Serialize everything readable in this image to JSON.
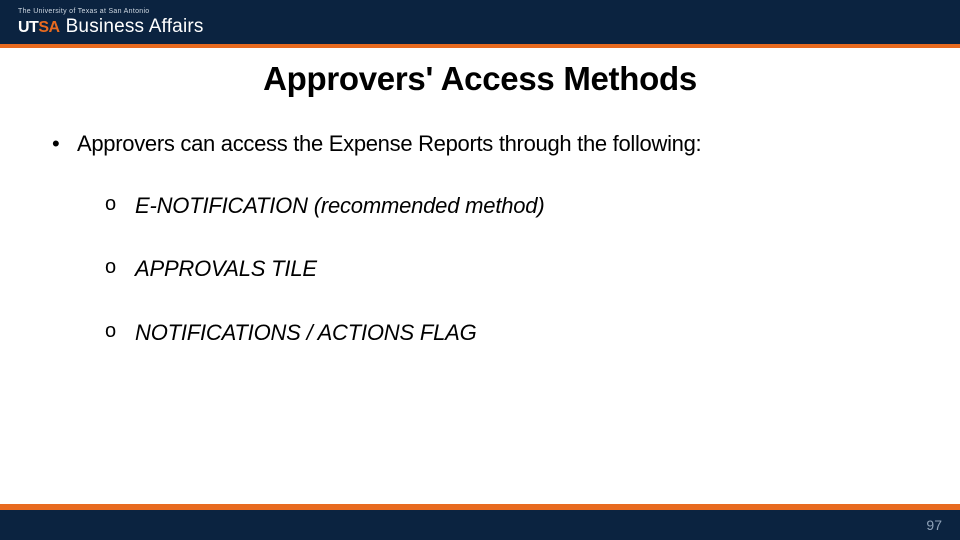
{
  "header": {
    "institution_line": "The University of Texas at San Antonio",
    "logo_mark_pre": "UT",
    "logo_mark_post": "SA",
    "department": "Business Affairs"
  },
  "title": "Approvers' Access Methods",
  "content": {
    "intro": "Approvers can access the Expense Reports through the following:",
    "methods": [
      "E-NOTIFICATION (recommended method)",
      "APPROVALS TILE",
      "NOTIFICATIONS / ACTIONS FLAG"
    ]
  },
  "footer": {
    "page_number": "97"
  }
}
